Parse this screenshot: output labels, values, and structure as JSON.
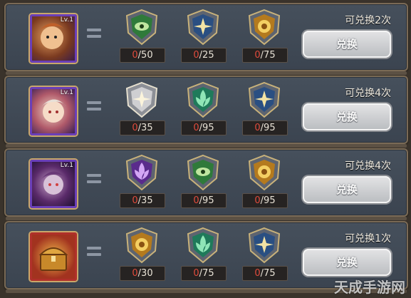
{
  "rows": [
    {
      "level": "Lv.1",
      "hero_icon": "hero-portrait-icon",
      "exchange_text": "可兑换2次",
      "button_label": "兑换",
      "costs": [
        {
          "icon": "green-eye-emblem-icon",
          "current": "0",
          "required": "/50"
        },
        {
          "icon": "blue-star-emblem-icon",
          "current": "0",
          "required": "/25"
        },
        {
          "icon": "gold-sun-emblem-icon",
          "current": "0",
          "required": "/75"
        }
      ]
    },
    {
      "level": "Lv.1",
      "hero_icon": "hero-portrait-icon",
      "exchange_text": "可兑换4次",
      "button_label": "兑换",
      "costs": [
        {
          "icon": "silver-star-emblem-icon",
          "current": "0",
          "required": "/35"
        },
        {
          "icon": "green-lotus-emblem-icon",
          "current": "0",
          "required": "/95"
        },
        {
          "icon": "blue-star-emblem-icon",
          "current": "0",
          "required": "/95"
        }
      ]
    },
    {
      "level": "Lv.1",
      "hero_icon": "hero-portrait-icon",
      "exchange_text": "可兑换4次",
      "button_label": "兑换",
      "costs": [
        {
          "icon": "purple-lotus-emblem-icon",
          "current": "0",
          "required": "/35"
        },
        {
          "icon": "green-eye-emblem-icon",
          "current": "0",
          "required": "/95"
        },
        {
          "icon": "gold-sun-emblem-icon",
          "current": "0",
          "required": "/95"
        }
      ]
    },
    {
      "level": "",
      "hero_icon": "treasure-chest-icon",
      "exchange_text": "可兑换1次",
      "button_label": "兑换",
      "costs": [
        {
          "icon": "gold-sun-emblem-icon",
          "current": "0",
          "required": "/30"
        },
        {
          "icon": "green-lotus-emblem-icon",
          "current": "0",
          "required": "/75"
        },
        {
          "icon": "blue-star-emblem-icon",
          "current": "0",
          "required": "/75"
        }
      ]
    }
  ],
  "watermark": "天成手游网",
  "colors": {
    "count_current": "#e04b3c",
    "panel": "#46505c",
    "portrait_border": "#6a3fb8"
  }
}
